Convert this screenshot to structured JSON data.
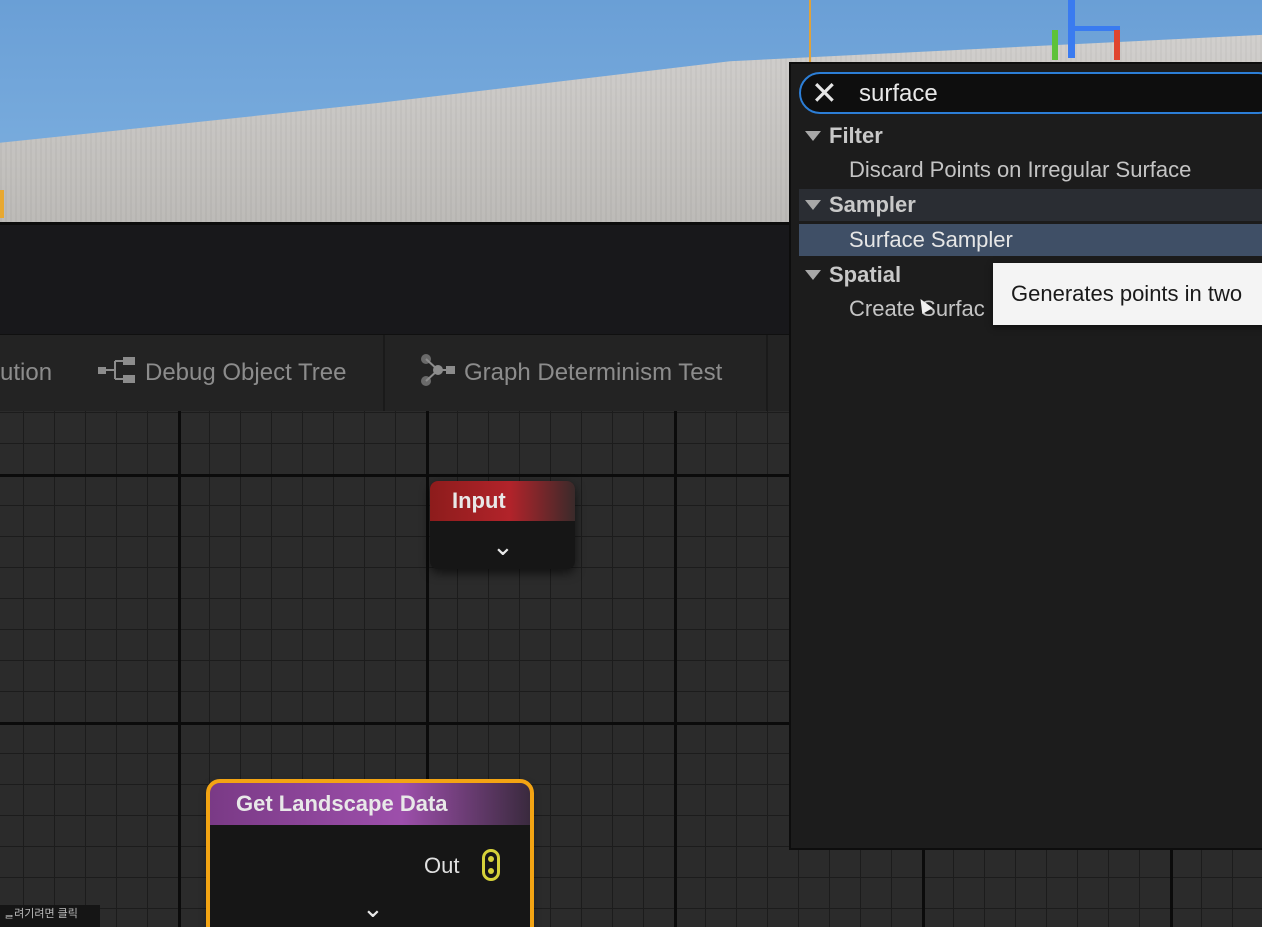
{
  "toolbar": {
    "partial_label": "ution",
    "debug_object_tree": "Debug Object Tree",
    "graph_determinism_test": "Graph Determinism Test"
  },
  "nodes": {
    "input": {
      "title": "Input"
    },
    "get_landscape_data": {
      "title": "Get Landscape Data",
      "out_pin": "Out"
    }
  },
  "action_menu": {
    "search": {
      "value": "surface"
    },
    "categories": [
      {
        "label": "Filter",
        "items": [
          "Discard Points on Irregular Surface"
        ]
      },
      {
        "label": "Sampler",
        "items": [
          "Surface Sampler"
        ]
      },
      {
        "label": "Spatial",
        "items": [
          "Create Surfac"
        ]
      }
    ],
    "selected_item": "Surface Sampler"
  },
  "tooltip": {
    "text": "Generates points in two"
  },
  "korean_tooltip": {
    "text": "ᆯ려기려면 클릭"
  },
  "colors": {
    "input_header": "#b2232a",
    "landscape_header": "#9d4fab",
    "selection_outline": "#f3a413",
    "search_border": "#2c7ed6",
    "selected_row": "#3f4f66"
  }
}
